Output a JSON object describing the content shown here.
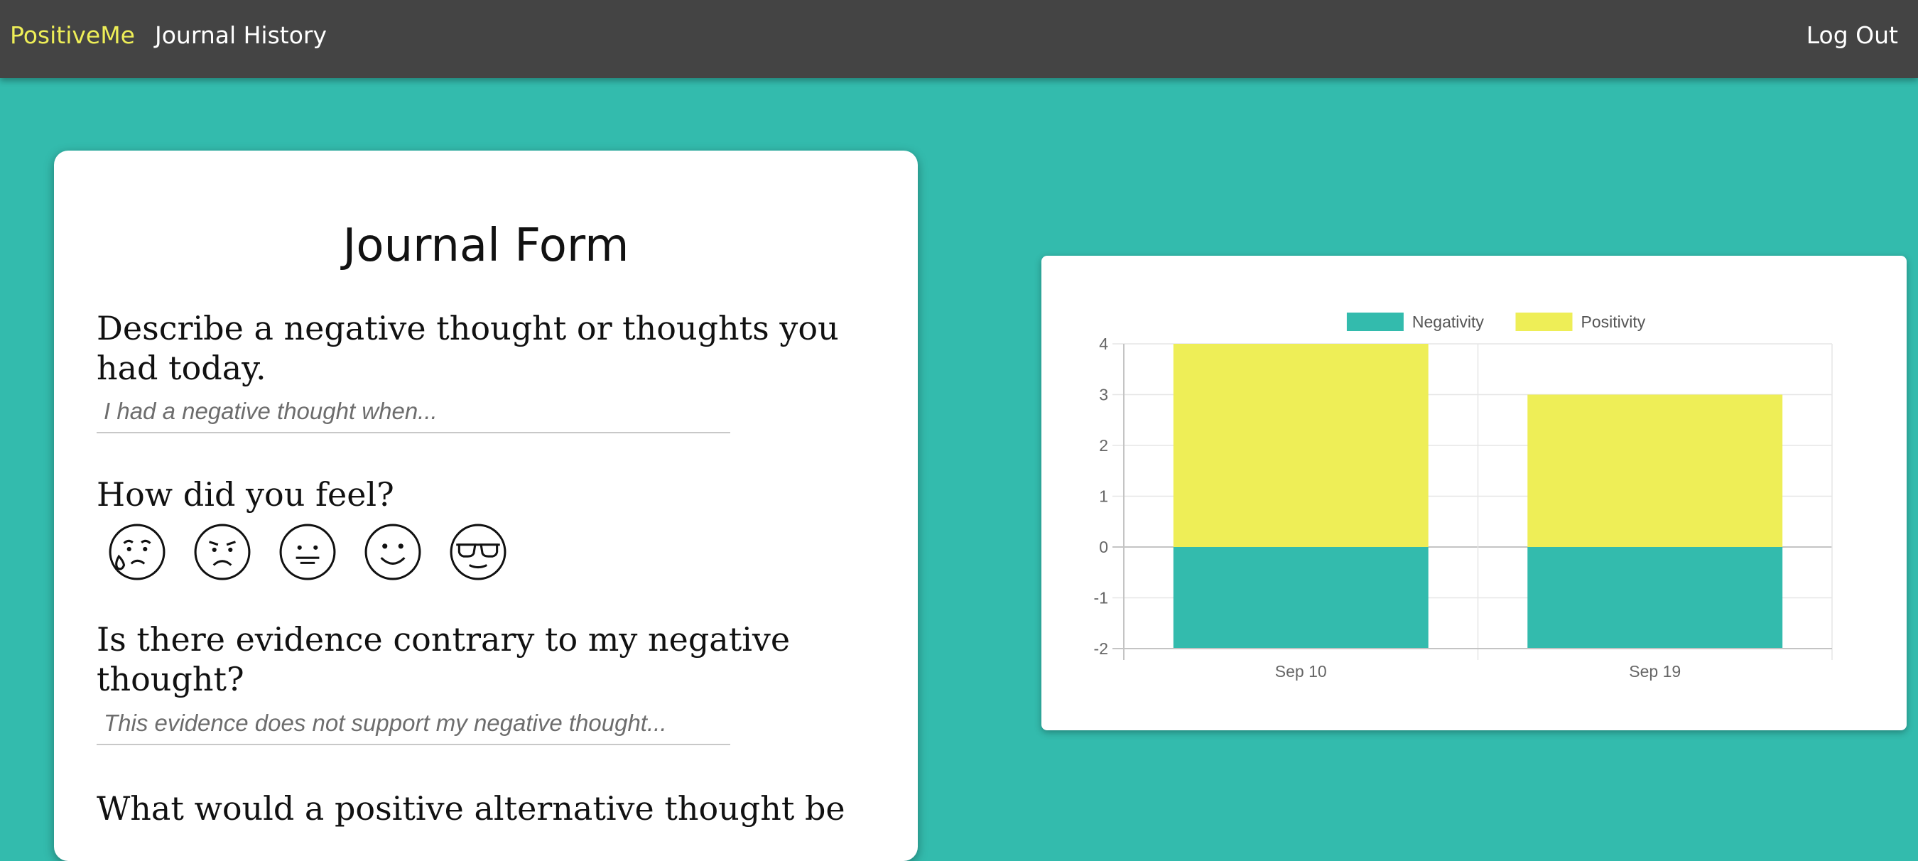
{
  "nav": {
    "brand": "PositiveMe",
    "history": "Journal History",
    "logout": "Log Out"
  },
  "form": {
    "title": "Journal Form",
    "q1": "Describe a negative thought or thoughts you had today.",
    "q1_placeholder": "I had a negative thought when...",
    "q2": "How did you feel?",
    "moods": [
      "crying-face-icon",
      "sad-face-icon",
      "neutral-face-icon",
      "smiling-face-icon",
      "cool-sunglasses-face-icon"
    ],
    "q3": "Is there evidence contrary to my negative thought?",
    "q3_placeholder": "This evidence does not support my negative thought...",
    "q4": "What would a positive alternative thought be"
  },
  "colors": {
    "background": "#33bbad",
    "navbar": "#444444",
    "brand": "#eeee57",
    "negativity": "#33bbad",
    "positivity": "#eeee57"
  },
  "chart_data": {
    "type": "bar",
    "stacked": true,
    "categories": [
      "Sep 10",
      "Sep 19"
    ],
    "series": [
      {
        "name": "Negativity",
        "color": "#33bbad",
        "values": [
          -2,
          -2
        ]
      },
      {
        "name": "Positivity",
        "color": "#eeee57",
        "values": [
          4,
          3
        ]
      }
    ],
    "ylim": [
      -2,
      4
    ],
    "yticks": [
      4,
      3,
      2,
      1,
      0,
      -1,
      -2
    ],
    "grid": true,
    "legend": "top-center",
    "title": "",
    "xlabel": "",
    "ylabel": ""
  }
}
